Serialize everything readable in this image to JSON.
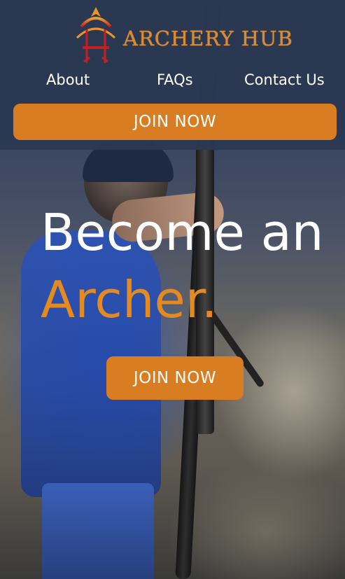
{
  "brand": {
    "name": "ARCHERY HUB",
    "logo_icon": "bow-and-arrows-icon",
    "color": "#e08a2c"
  },
  "nav": {
    "items": [
      {
        "label": "About"
      },
      {
        "label": "FAQs"
      },
      {
        "label": "Contact Us"
      }
    ]
  },
  "header": {
    "cta_label": "JOIN NOW"
  },
  "hero": {
    "title_line1": "Become an",
    "title_line2": "Archer.",
    "cta_label": "JOIN NOW"
  },
  "colors": {
    "accent": "#d87d21",
    "header_bg": "#2b3852",
    "title_white": "#ffffff",
    "title_orange": "#e58a1e"
  }
}
